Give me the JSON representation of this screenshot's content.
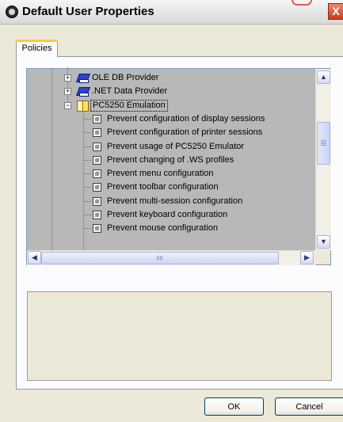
{
  "window": {
    "title": "Default User Properties",
    "close_label": "X"
  },
  "tabs": [
    {
      "label": "Policies",
      "active": true
    }
  ],
  "tree": {
    "nodes": [
      {
        "label": "OLE DB Provider",
        "expander": "+",
        "icon": "book-icon",
        "level": 1
      },
      {
        "label": ".NET Data Provider",
        "expander": "+",
        "icon": "book-icon",
        "level": 1
      },
      {
        "label": "PC5250 Emulation",
        "expander": "−",
        "icon": "open-book-icon",
        "level": 1,
        "selected": true
      },
      {
        "label": "Prevent configuration of display sessions",
        "icon": "policy-icon",
        "level": 2
      },
      {
        "label": "Prevent configuration of printer sessions",
        "icon": "policy-icon",
        "level": 2
      },
      {
        "label": "Prevent usage of PC5250 Emulator",
        "icon": "policy-icon",
        "level": 2
      },
      {
        "label": "Prevent changing of .WS profiles",
        "icon": "policy-icon",
        "level": 2
      },
      {
        "label": "Prevent menu configuration",
        "icon": "policy-icon",
        "level": 2
      },
      {
        "label": "Prevent toolbar configuration",
        "icon": "policy-icon",
        "level": 2
      },
      {
        "label": "Prevent multi-session configuration",
        "icon": "policy-icon",
        "level": 2
      },
      {
        "label": "Prevent keyboard configuration",
        "icon": "policy-icon",
        "level": 2
      },
      {
        "label": "Prevent mouse configuration",
        "icon": "policy-icon",
        "level": 2
      }
    ],
    "scroll_up": "▲",
    "scroll_down": "▼",
    "scroll_left": "◀",
    "scroll_right": "▶"
  },
  "description": {
    "text": ""
  },
  "buttons": {
    "ok": "OK",
    "cancel": "Cancel"
  },
  "colors": {
    "dialog_bg": "#ece9d8",
    "tree_bg": "#b8b8b8",
    "close_red": "#c73f1c",
    "tab_highlight": "#ffc73c"
  }
}
